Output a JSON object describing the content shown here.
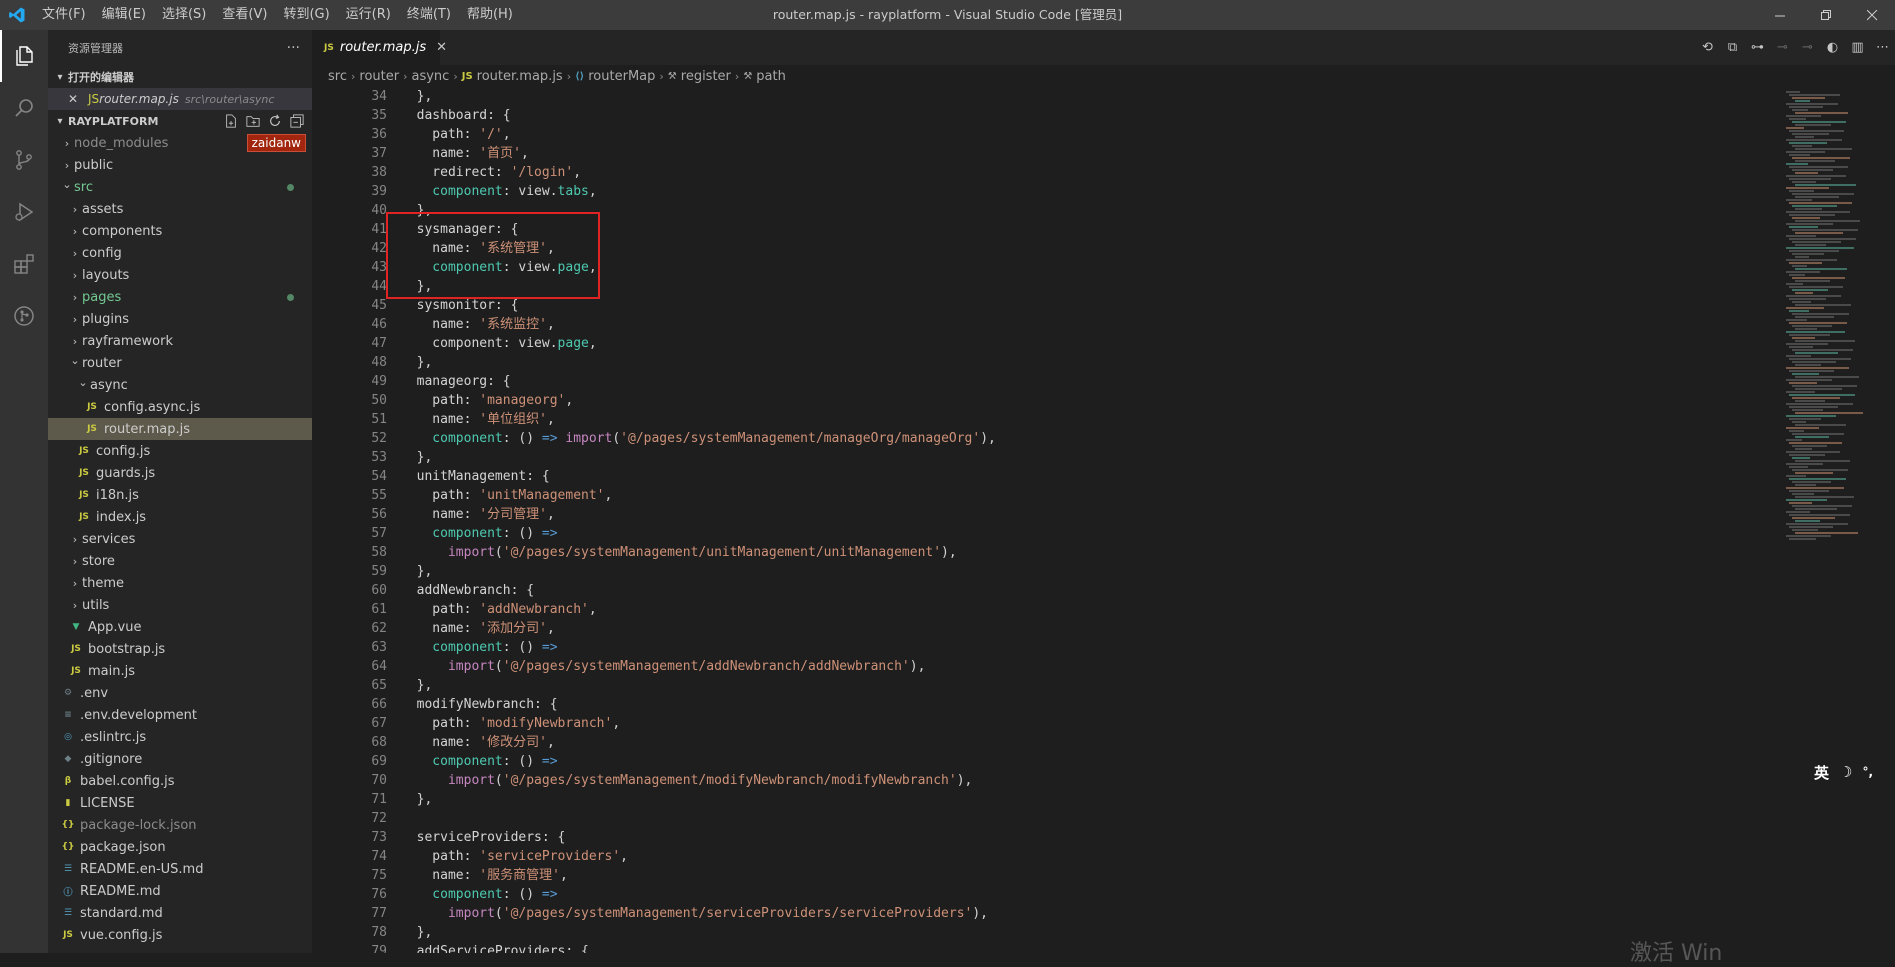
{
  "menubar": {
    "items": [
      "文件(F)",
      "编辑(E)",
      "选择(S)",
      "查看(V)",
      "转到(G)",
      "运行(R)",
      "终端(T)",
      "帮助(H)"
    ]
  },
  "window": {
    "title": "router.map.js - rayplatform - Visual Studio Code [管理员]"
  },
  "sidebar": {
    "title": "资源管理器",
    "more": "···",
    "open_editors_label": "打开的编辑器",
    "open_editor": {
      "name": "router.map.js",
      "path": "src\\router\\async"
    },
    "project_label": "RAYPLATFORM",
    "tooltip": "zaidanw",
    "tree": [
      {
        "label": "node_modules",
        "indent": 0,
        "kind": "folder",
        "open": false,
        "dim": true
      },
      {
        "label": "public",
        "indent": 0,
        "kind": "folder",
        "open": false
      },
      {
        "label": "src",
        "indent": 0,
        "kind": "folder",
        "open": true,
        "color": "#73c991",
        "dot": true
      },
      {
        "label": "assets",
        "indent": 1,
        "kind": "folder",
        "open": false
      },
      {
        "label": "components",
        "indent": 1,
        "kind": "folder",
        "open": false
      },
      {
        "label": "config",
        "indent": 1,
        "kind": "folder",
        "open": false
      },
      {
        "label": "layouts",
        "indent": 1,
        "kind": "folder",
        "open": false
      },
      {
        "label": "pages",
        "indent": 1,
        "kind": "folder",
        "open": false,
        "color": "#73c991",
        "dot": true
      },
      {
        "label": "plugins",
        "indent": 1,
        "kind": "folder",
        "open": false
      },
      {
        "label": "rayframework",
        "indent": 1,
        "kind": "folder",
        "open": false
      },
      {
        "label": "router",
        "indent": 1,
        "kind": "folder",
        "open": true
      },
      {
        "label": "async",
        "indent": 2,
        "kind": "folder",
        "open": true
      },
      {
        "label": "config.async.js",
        "indent": 3,
        "kind": "js"
      },
      {
        "label": "router.map.js",
        "indent": 3,
        "kind": "js",
        "selected": true
      },
      {
        "label": "config.js",
        "indent": 2,
        "kind": "js"
      },
      {
        "label": "guards.js",
        "indent": 2,
        "kind": "js"
      },
      {
        "label": "i18n.js",
        "indent": 2,
        "kind": "js"
      },
      {
        "label": "index.js",
        "indent": 2,
        "kind": "js"
      },
      {
        "label": "services",
        "indent": 1,
        "kind": "folder",
        "open": false
      },
      {
        "label": "store",
        "indent": 1,
        "kind": "folder",
        "open": false
      },
      {
        "label": "theme",
        "indent": 1,
        "kind": "folder",
        "open": false
      },
      {
        "label": "utils",
        "indent": 1,
        "kind": "folder",
        "open": false
      },
      {
        "label": "App.vue",
        "indent": 1,
        "kind": "vue"
      },
      {
        "label": "bootstrap.js",
        "indent": 1,
        "kind": "js"
      },
      {
        "label": "main.js",
        "indent": 1,
        "kind": "js"
      },
      {
        "label": ".env",
        "indent": 0,
        "kind": "gear"
      },
      {
        "label": ".env.development",
        "indent": 0,
        "kind": "lines"
      },
      {
        "label": ".eslintrc.js",
        "indent": 0,
        "kind": "eslint"
      },
      {
        "label": ".gitignore",
        "indent": 0,
        "kind": "git"
      },
      {
        "label": "babel.config.js",
        "indent": 0,
        "kind": "babel"
      },
      {
        "label": "LICENSE",
        "indent": 0,
        "kind": "license"
      },
      {
        "label": "package-lock.json",
        "indent": 0,
        "kind": "json",
        "dim": true
      },
      {
        "label": "package.json",
        "indent": 0,
        "kind": "json"
      },
      {
        "label": "README.en-US.md",
        "indent": 0,
        "kind": "md"
      },
      {
        "label": "README.md",
        "indent": 0,
        "kind": "info"
      },
      {
        "label": "standard.md",
        "indent": 0,
        "kind": "md"
      },
      {
        "label": "vue.config.js",
        "indent": 0,
        "kind": "js"
      }
    ]
  },
  "editor": {
    "tab": {
      "label": "router.map.js",
      "badge": "JS"
    },
    "breadcrumb": [
      "src",
      "router",
      "async",
      "router.map.js",
      "routerMap",
      "register",
      "path"
    ],
    "lines": [
      {
        "n": "34",
        "t": [
          [
            "tx",
            "  },"
          ]
        ]
      },
      {
        "n": "35",
        "t": [
          [
            "tx",
            "  dashboard: {"
          ]
        ]
      },
      {
        "n": "36",
        "t": [
          [
            "tx",
            "    path: "
          ],
          [
            "s",
            "'/'"
          ],
          [
            "tx",
            ","
          ]
        ]
      },
      {
        "n": "37",
        "t": [
          [
            "tx",
            "    name: "
          ],
          [
            "s",
            "'首页'"
          ],
          [
            "tx",
            ","
          ]
        ]
      },
      {
        "n": "38",
        "t": [
          [
            "tx",
            "    redirect: "
          ],
          [
            "s",
            "'/login'"
          ],
          [
            "tx",
            ","
          ]
        ]
      },
      {
        "n": "39",
        "t": [
          [
            "comp",
            "    component"
          ],
          [
            "tx",
            ": view."
          ],
          [
            "comp",
            "tabs"
          ],
          [
            "tx",
            ","
          ]
        ]
      },
      {
        "n": "40",
        "t": [
          [
            "tx",
            "  },"
          ]
        ]
      },
      {
        "n": "41",
        "t": [
          [
            "tx",
            "  sysmanager: {"
          ]
        ]
      },
      {
        "n": "42",
        "t": [
          [
            "tx",
            "    name: "
          ],
          [
            "s",
            "'系统管理'"
          ],
          [
            "tx",
            ","
          ]
        ]
      },
      {
        "n": "43",
        "t": [
          [
            "comp",
            "    component"
          ],
          [
            "tx",
            ": view."
          ],
          [
            "comp",
            "page"
          ],
          [
            "tx",
            ","
          ]
        ]
      },
      {
        "n": "44",
        "t": [
          [
            "tx",
            "  },"
          ]
        ]
      },
      {
        "n": "45",
        "t": [
          [
            "tx",
            "  sysmonitor: {"
          ]
        ]
      },
      {
        "n": "46",
        "t": [
          [
            "tx",
            "    name: "
          ],
          [
            "s",
            "'系统监控'"
          ],
          [
            "tx",
            ","
          ]
        ]
      },
      {
        "n": "47",
        "t": [
          [
            "tx",
            "    component: view."
          ],
          [
            "comp",
            "page"
          ],
          [
            "tx",
            ","
          ]
        ]
      },
      {
        "n": "48",
        "t": [
          [
            "tx",
            "  },"
          ]
        ]
      },
      {
        "n": "49",
        "t": [
          [
            "tx",
            "  manageorg: {"
          ]
        ]
      },
      {
        "n": "50",
        "t": [
          [
            "tx",
            "    path: "
          ],
          [
            "s",
            "'manageorg'"
          ],
          [
            "tx",
            ","
          ]
        ]
      },
      {
        "n": "51",
        "t": [
          [
            "tx",
            "    name: "
          ],
          [
            "s",
            "'单位组织'"
          ],
          [
            "tx",
            ","
          ]
        ]
      },
      {
        "n": "52",
        "t": [
          [
            "comp",
            "    component"
          ],
          [
            "tx",
            ": () "
          ],
          [
            "arrowop",
            "=>"
          ],
          [
            "tx",
            " "
          ],
          [
            "fn",
            "import"
          ],
          [
            "tx",
            "("
          ],
          [
            "s",
            "'@/pages/systemManagement/manageOrg/manageOrg'"
          ],
          [
            "tx",
            "),"
          ]
        ]
      },
      {
        "n": "53",
        "t": [
          [
            "tx",
            "  },"
          ]
        ]
      },
      {
        "n": "54",
        "t": [
          [
            "tx",
            "  unitManagement: {"
          ]
        ]
      },
      {
        "n": "55",
        "t": [
          [
            "tx",
            "    path: "
          ],
          [
            "s",
            "'unitManagement'"
          ],
          [
            "tx",
            ","
          ]
        ]
      },
      {
        "n": "56",
        "t": [
          [
            "tx",
            "    name: "
          ],
          [
            "s",
            "'分司管理'"
          ],
          [
            "tx",
            ","
          ]
        ]
      },
      {
        "n": "57",
        "t": [
          [
            "comp",
            "    component"
          ],
          [
            "tx",
            ": () "
          ],
          [
            "arrowop",
            "=>"
          ]
        ]
      },
      {
        "n": "58",
        "t": [
          [
            "fn",
            "      import"
          ],
          [
            "tx",
            "("
          ],
          [
            "s",
            "'@/pages/systemManagement/unitManagement/unitManagement'"
          ],
          [
            "tx",
            "),"
          ]
        ]
      },
      {
        "n": "59",
        "t": [
          [
            "tx",
            "  },"
          ]
        ]
      },
      {
        "n": "60",
        "t": [
          [
            "tx",
            "  addNewbranch: {"
          ]
        ]
      },
      {
        "n": "61",
        "t": [
          [
            "tx",
            "    path: "
          ],
          [
            "s",
            "'addNewbranch'"
          ],
          [
            "tx",
            ","
          ]
        ]
      },
      {
        "n": "62",
        "t": [
          [
            "tx",
            "    name: "
          ],
          [
            "s",
            "'添加分司'"
          ],
          [
            "tx",
            ","
          ]
        ]
      },
      {
        "n": "63",
        "t": [
          [
            "comp",
            "    component"
          ],
          [
            "tx",
            ": () "
          ],
          [
            "arrowop",
            "=>"
          ]
        ]
      },
      {
        "n": "64",
        "t": [
          [
            "fn",
            "      import"
          ],
          [
            "tx",
            "("
          ],
          [
            "s",
            "'@/pages/systemManagement/addNewbranch/addNewbranch'"
          ],
          [
            "tx",
            "),"
          ]
        ]
      },
      {
        "n": "65",
        "t": [
          [
            "tx",
            "  },"
          ]
        ]
      },
      {
        "n": "66",
        "t": [
          [
            "tx",
            "  modifyNewbranch: {"
          ]
        ]
      },
      {
        "n": "67",
        "t": [
          [
            "tx",
            "    path: "
          ],
          [
            "s",
            "'modifyNewbranch'"
          ],
          [
            "tx",
            ","
          ]
        ]
      },
      {
        "n": "68",
        "t": [
          [
            "tx",
            "    name: "
          ],
          [
            "s",
            "'修改分司'"
          ],
          [
            "tx",
            ","
          ]
        ]
      },
      {
        "n": "69",
        "t": [
          [
            "comp",
            "    component"
          ],
          [
            "tx",
            ": () "
          ],
          [
            "arrowop",
            "=>"
          ]
        ]
      },
      {
        "n": "70",
        "t": [
          [
            "fn",
            "      import"
          ],
          [
            "tx",
            "("
          ],
          [
            "s",
            "'@/pages/systemManagement/modifyNewbranch/modifyNewbranch'"
          ],
          [
            "tx",
            "),"
          ]
        ]
      },
      {
        "n": "71",
        "t": [
          [
            "tx",
            "  },"
          ]
        ]
      },
      {
        "n": "72",
        "t": [
          [
            "tx",
            ""
          ]
        ]
      },
      {
        "n": "73",
        "t": [
          [
            "tx",
            "  serviceProviders: {"
          ]
        ]
      },
      {
        "n": "74",
        "t": [
          [
            "tx",
            "    path: "
          ],
          [
            "s",
            "'serviceProviders'"
          ],
          [
            "tx",
            ","
          ]
        ]
      },
      {
        "n": "75",
        "t": [
          [
            "tx",
            "    name: "
          ],
          [
            "s",
            "'服务商管理'"
          ],
          [
            "tx",
            ","
          ]
        ]
      },
      {
        "n": "76",
        "t": [
          [
            "comp",
            "    component"
          ],
          [
            "tx",
            ": () "
          ],
          [
            "arrowop",
            "=>"
          ]
        ]
      },
      {
        "n": "77",
        "t": [
          [
            "fn",
            "      import"
          ],
          [
            "tx",
            "("
          ],
          [
            "s",
            "'@/pages/systemManagement/serviceProviders/serviceProviders'"
          ],
          [
            "tx",
            "),"
          ]
        ]
      },
      {
        "n": "78",
        "t": [
          [
            "tx",
            "  },"
          ]
        ]
      },
      {
        "n": "79",
        "t": [
          [
            "tx",
            "  addServiceProviders: {"
          ]
        ]
      }
    ]
  },
  "ime": {
    "lang": "英",
    "moon": "☽",
    "punct": "°,"
  },
  "watermark": "激活 Win"
}
